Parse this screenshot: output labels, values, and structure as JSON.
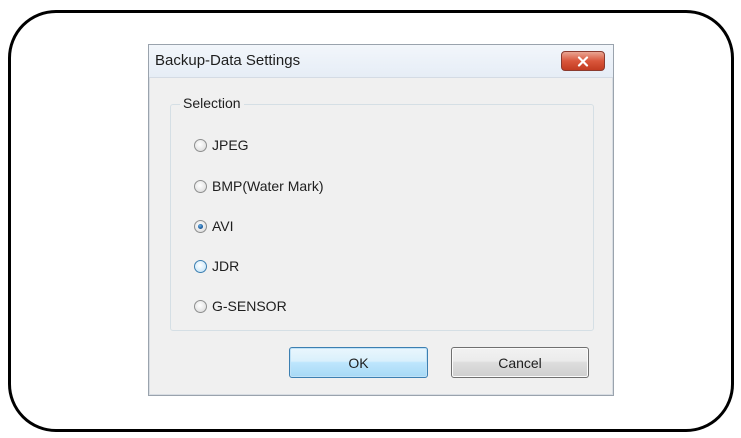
{
  "dialog": {
    "title": "Backup-Data Settings",
    "close_icon": "close-icon"
  },
  "selection": {
    "legend": "Selection",
    "options": [
      {
        "label": "JPEG",
        "selected": false
      },
      {
        "label": "BMP(Water Mark)",
        "selected": false
      },
      {
        "label": "AVI",
        "selected": true
      },
      {
        "label": "JDR",
        "selected": false,
        "hovered": true
      },
      {
        "label": "G-SENSOR",
        "selected": false
      }
    ]
  },
  "buttons": {
    "ok_label": "OK",
    "cancel_label": "Cancel"
  },
  "colors": {
    "close_button": "#c94a30",
    "ok_button_border": "#3c7fb1",
    "radio_dot": "#1d5fa0"
  }
}
